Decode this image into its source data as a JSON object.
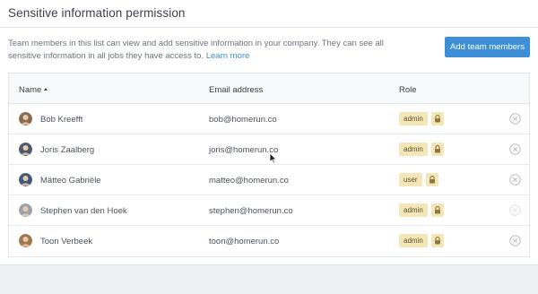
{
  "panel": {
    "title": "Sensitive information permission",
    "description": "Team members in this list can view and add sensitive information in your company. They can see all sensitive information in all jobs they have access to.",
    "learn_more": "Learn more",
    "add_button": "Add team members"
  },
  "table": {
    "headers": {
      "name": "Name",
      "email": "Email address",
      "role": "Role"
    },
    "rows": [
      {
        "name": "Bob Kreefft",
        "email": "bob@homerun.co",
        "role": "admin",
        "avatar_color": "#8a6a4f"
      },
      {
        "name": "Joris Zaalberg",
        "email": "joris@homerun.co",
        "role": "admin",
        "avatar_color": "#4d5a6e"
      },
      {
        "name": "Mätteo Gabriële",
        "email": "matteo@homerun.co",
        "role": "user",
        "avatar_color": "#3e5a7a"
      },
      {
        "name": "Stephen van den Hoek",
        "email": "stephen@homerun.co",
        "role": "admin",
        "avatar_color": "#9aa3ad"
      },
      {
        "name": "Toon Verbeek",
        "email": "toon@homerun.co",
        "role": "admin",
        "avatar_color": "#a0764e"
      }
    ]
  },
  "colors": {
    "accent": "#3d8fd8",
    "badge_bg": "#f5e6b8",
    "remove_icon": "#b8bcc3"
  }
}
